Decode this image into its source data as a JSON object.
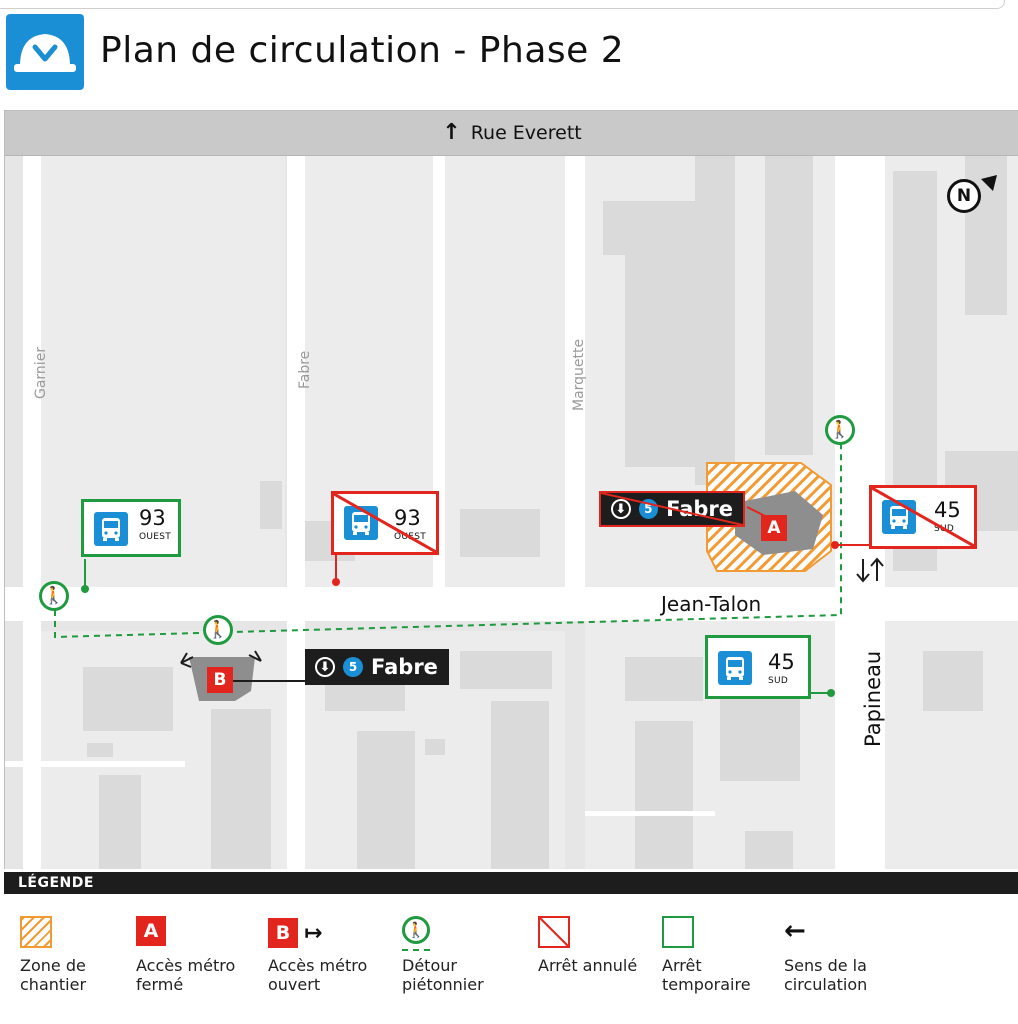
{
  "header": {
    "title": "Plan de circulation - Phase 2",
    "logo_icon": "hard-hat-icon"
  },
  "map": {
    "top_street": {
      "label": "Rue Everett",
      "icon": "arrow-up-icon"
    },
    "streets": {
      "garnier": "Garnier",
      "fabre": "Fabre",
      "marquette": "Marquette",
      "jean_talon": "Jean-Talon",
      "papineau": "Papineau"
    },
    "north_label": "N",
    "bus_stops": [
      {
        "route": "93",
        "direction": "OUEST",
        "status": "temporaire"
      },
      {
        "route": "93",
        "direction": "OUEST",
        "status": "annulé"
      },
      {
        "route": "45",
        "direction": "SUD",
        "status": "annulé"
      },
      {
        "route": "45",
        "direction": "SUD",
        "status": "temporaire"
      }
    ],
    "metro_labels": [
      {
        "line": "5",
        "station": "Fabre",
        "access": "A",
        "status": "fermé"
      },
      {
        "line": "5",
        "station": "Fabre",
        "access": "B",
        "status": "ouvert"
      }
    ],
    "traffic_direction_icon": "two-way-arrows-icon"
  },
  "legend": {
    "title": "LÉGENDE",
    "items": [
      {
        "label": "Zone de chantier"
      },
      {
        "label": "Accès métro fermé",
        "badge": "A"
      },
      {
        "label": "Accès métro ouvert",
        "badge": "B"
      },
      {
        "label": "Détour piétonnier"
      },
      {
        "label": "Arrêt annulé"
      },
      {
        "label": "Arrêt temporaire"
      },
      {
        "label": "Sens de la circulation"
      }
    ]
  },
  "colors": {
    "accent_blue": "#1a8fd6",
    "closed_red": "#e3261d",
    "temporary_green": "#1f9a3f",
    "worksite_orange": "#f29a34",
    "map_gray": "#e6e6e6"
  }
}
